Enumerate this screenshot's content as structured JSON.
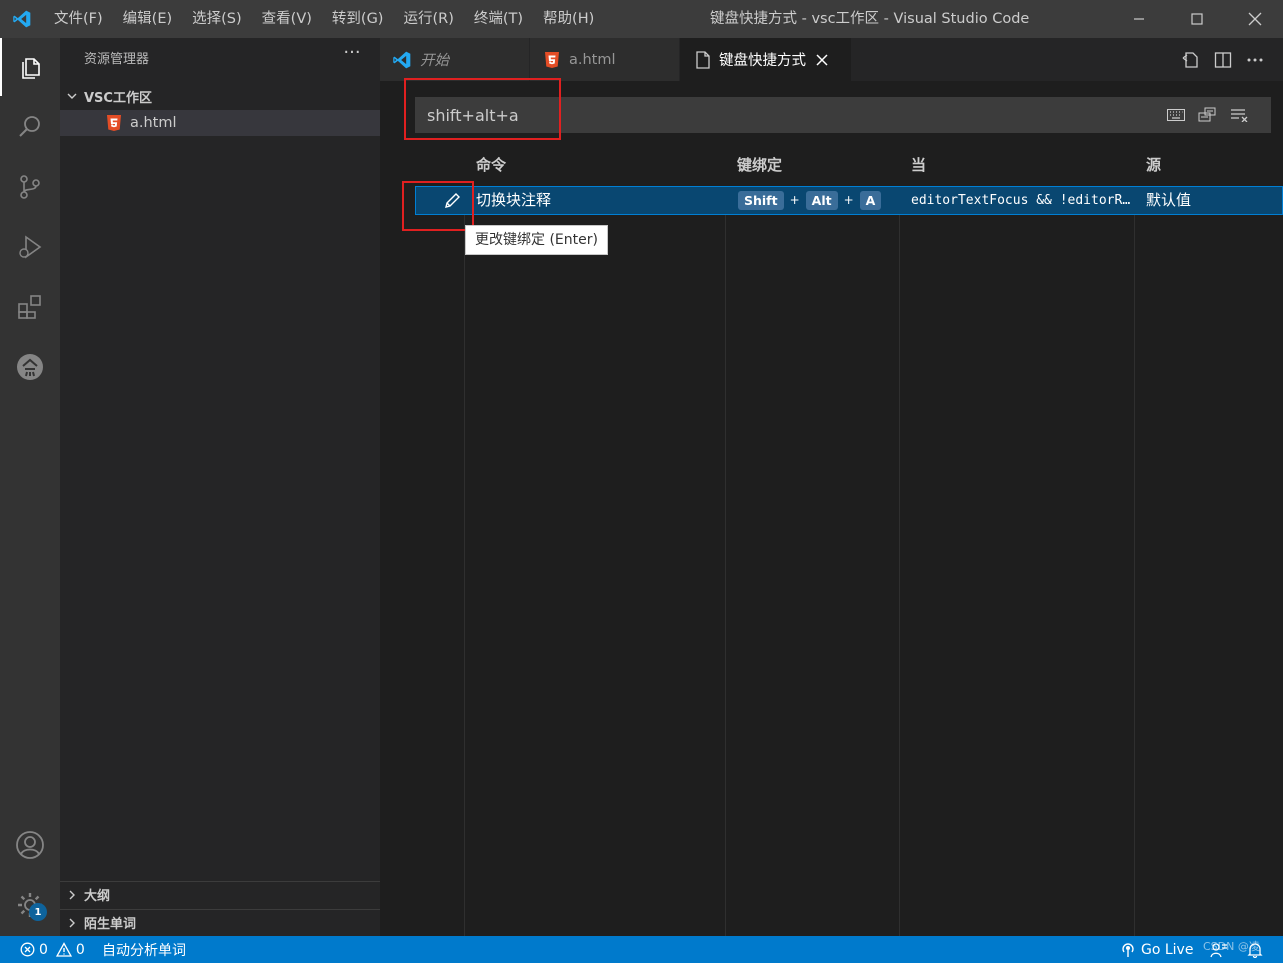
{
  "menu": [
    "文件(F)",
    "编辑(E)",
    "选择(S)",
    "查看(V)",
    "转到(G)",
    "运行(R)",
    "终端(T)",
    "帮助(H)"
  ],
  "window_title": "键盘快捷方式 - vsc工作区 - Visual Studio Code",
  "activity": {
    "accounts_badge": "1"
  },
  "sidebar": {
    "title": "资源管理器",
    "more": "···",
    "folder": "VSC工作区",
    "file": "a.html",
    "outline": "大纲",
    "unknown_words": "陌生单词"
  },
  "tabs": [
    {
      "label": "开始",
      "icon": "vscode-icon"
    },
    {
      "label": "a.html",
      "icon": "html5-icon"
    },
    {
      "label": "键盘快捷方式",
      "icon": "file-icon"
    }
  ],
  "search": {
    "value": "shift+alt+a"
  },
  "table": {
    "headers": [
      "命令",
      "键绑定",
      "当",
      "源"
    ],
    "rows": [
      {
        "command": "切换块注释",
        "keys": [
          "Shift",
          "Alt",
          "A"
        ],
        "plus": "+",
        "when": "editorTextFocus && !editorReadonly",
        "source": "默认值"
      }
    ]
  },
  "tooltip": "更改键绑定 (Enter)",
  "statusbar": {
    "errors": "0",
    "warnings": "0",
    "analyze": "自动分析单词",
    "golive": "Go Live",
    "watermark": "CSDN @凌"
  },
  "colors": {
    "accent": "#007acc",
    "highlight": "#e02020",
    "selection": "#094771"
  }
}
